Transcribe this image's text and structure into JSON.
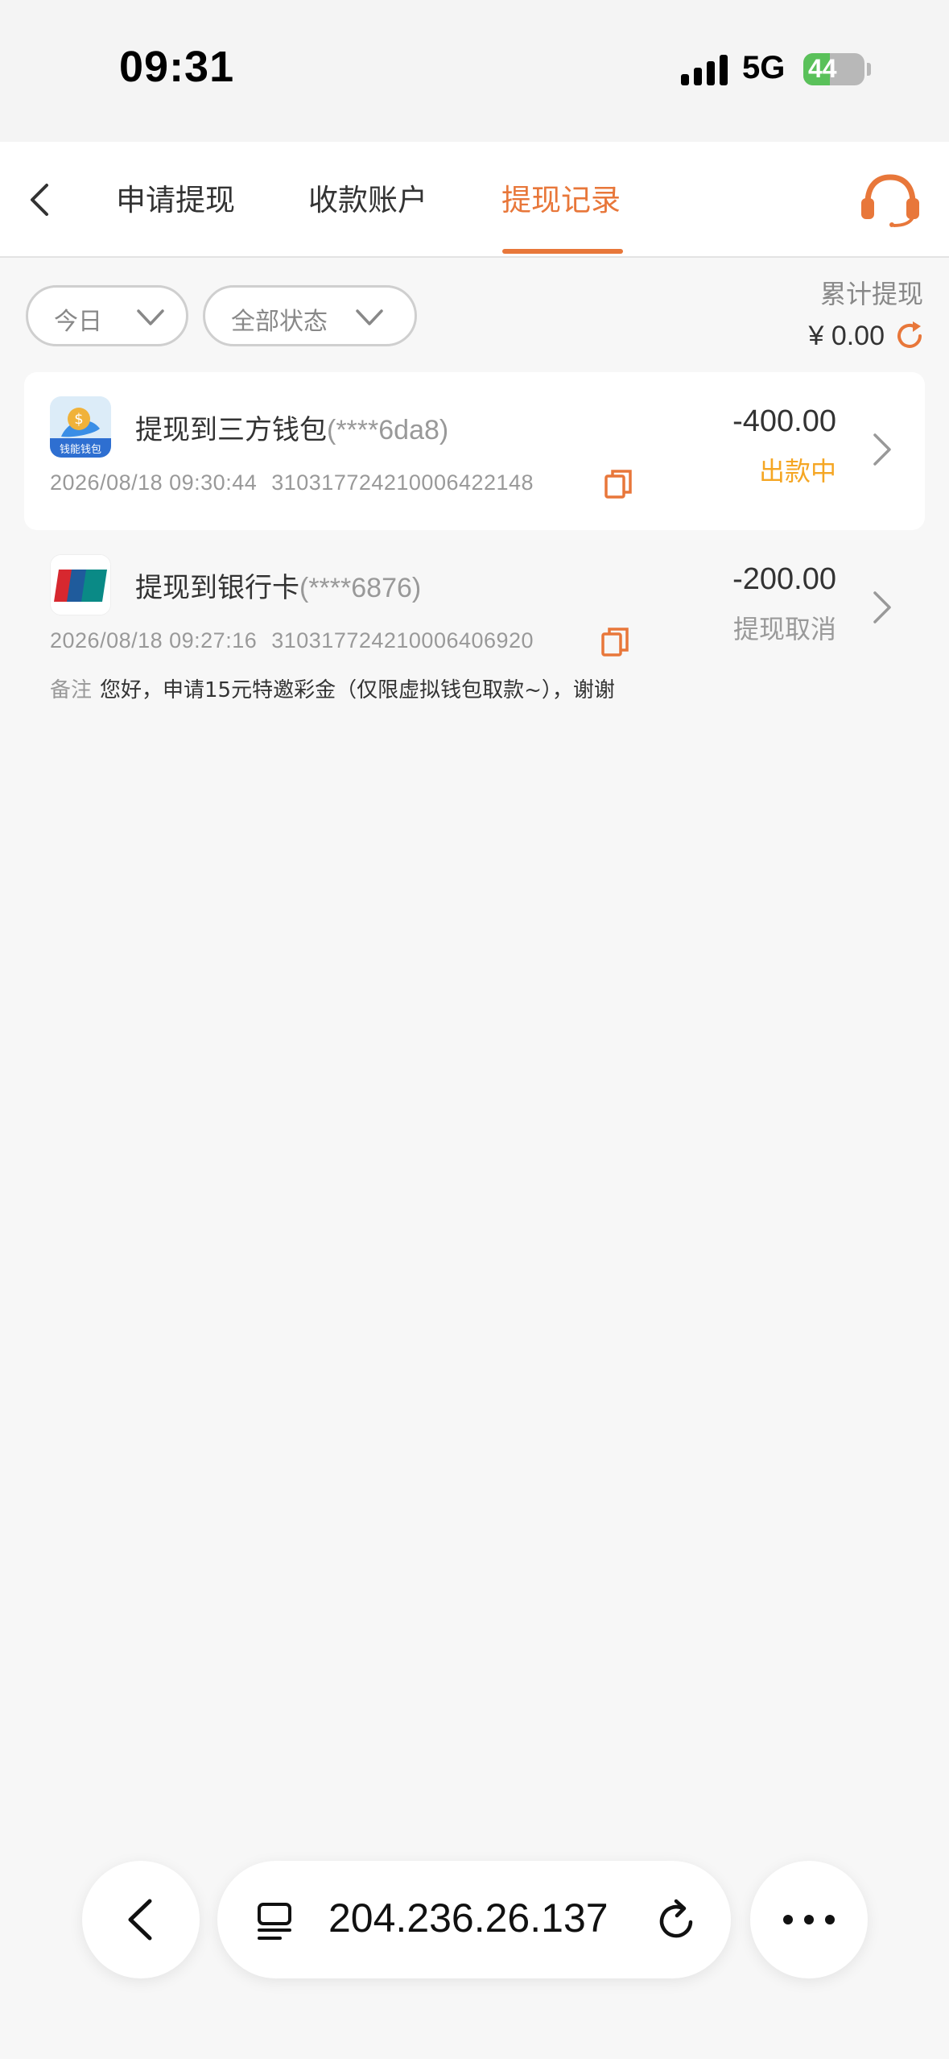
{
  "status_bar": {
    "time": "09:31",
    "network": "5G",
    "battery": "44",
    "battery_level": 0.44
  },
  "header": {
    "tabs": [
      {
        "label": "申请提现",
        "active": false
      },
      {
        "label": "收款账户",
        "active": false
      },
      {
        "label": "提现记录",
        "active": true
      }
    ],
    "accent_color": "#e8773a"
  },
  "filters": {
    "date": "今日",
    "status": "全部状态"
  },
  "summary": {
    "title": "累计提现",
    "amount": "¥ 0.00"
  },
  "records": [
    {
      "title": "提现到三方钱包",
      "account": "(****6da8)",
      "datetime": "2026/08/18 09:30:44",
      "order_no": "310317724210006422148",
      "amount": "-400.00",
      "status": "出款中",
      "status_color": "#f5a623",
      "icon": "wallet-app-icon",
      "icon_label": "钱能钱包"
    },
    {
      "title": "提现到银行卡",
      "account": "(****6876)",
      "datetime": "2026/08/18 09:27:16",
      "order_no": "310317724210006406920",
      "amount": "-200.00",
      "status": "提现取消",
      "status_color": "#999999",
      "icon": "unionpay-icon",
      "note_label": "备注",
      "note": "您好，申请15元特邀彩金（仅限虚拟钱包取款~），谢谢"
    }
  ],
  "browser_bar": {
    "url": "204.236.26.137"
  }
}
